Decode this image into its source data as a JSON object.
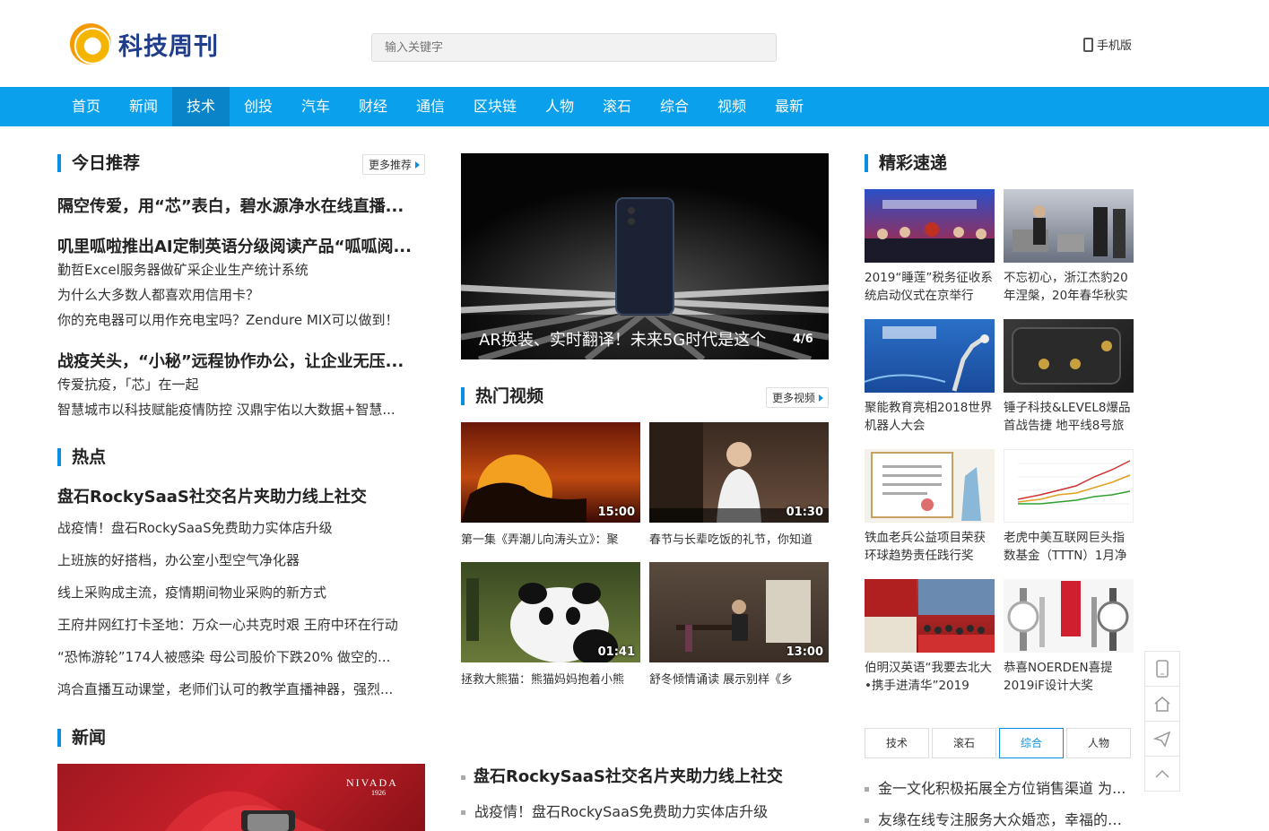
{
  "header": {
    "logo_text": "科技周刊",
    "search_placeholder": "输入关键字",
    "mobile_label": "手机版"
  },
  "nav": [
    "首页",
    "新闻",
    "技术",
    "创投",
    "汽车",
    "财经",
    "通信",
    "区块链",
    "人物",
    "滚石",
    "综合",
    "视频",
    "最新"
  ],
  "nav_active": "技术",
  "today": {
    "title": "今日推荐",
    "more": "更多推荐",
    "groups": [
      {
        "headline": "隔空传爱，用“芯”表白，碧水源净水在线直播...",
        "links": []
      },
      {
        "headline": "叽里呱啦推出AI定制英语分级阅读产品“呱呱阅...",
        "links": [
          "勤哲Excel服务器做矿采企业生产统计系统",
          "为什么大多数人都喜欢用信用卡？",
          "你的充电器可以用作充电宝吗？Zendure MIX可以做到！"
        ]
      },
      {
        "headline": "战疫关头，“小秘”远程协作办公，让企业无压...",
        "links": [
          "传爱抗疫，「芯」在一起",
          "智慧城市以科技赋能疫情防控 汉鼎宇佑以大数据+智慧..."
        ]
      }
    ]
  },
  "hot": {
    "title": "热点",
    "headline": "盘石RockySaaS社交名片夹助力线上社交",
    "links": [
      "战疫情！盘石RockySaaS免费助力实体店升级",
      "上班族的好搭档，办公室小型空气净化器",
      "线上采购成主流，疫情期间物业采购的新方式",
      "王府井网红打卡圣地：万众一心共克时艰 王府中环在行动",
      "“恐怖游轮”174人被感染 母公司股价下跌20% 做空的...",
      "鸿合直播互动课堂，老师们认可的教学直播神器，强烈..."
    ]
  },
  "news": {
    "title": "新闻",
    "ad_brand": "NIVADA",
    "ad_year": "1926"
  },
  "slider": {
    "caption": "AR换装、实时翻译！未来5G时代是这个",
    "counter": "4/6"
  },
  "videos": {
    "title": "热门视频",
    "more": "更多视频",
    "items": [
      {
        "caption": "第一集《弄潮儿向涛头立》：聚",
        "duration": "15:00"
      },
      {
        "caption": "春节与长辈吃饭的礼节，你知道",
        "duration": "01:30"
      },
      {
        "caption": "拯救大熊猫：熊猫妈妈抱着小熊",
        "duration": "01:41"
      },
      {
        "caption": "舒冬倾情诵读 展示别样《乡",
        "duration": "13:00"
      }
    ]
  },
  "center_list": [
    "盘石RockySaaS社交名片夹助力线上社交",
    "战疫情！盘石RockySaaS免费助力实体店升级"
  ],
  "express": {
    "title": "精彩速递",
    "items": [
      {
        "caption": "2019“睡莲”税务征收系统启动仪式在京举行",
        "icon": "ceremony-photo"
      },
      {
        "caption": "不忘初心，浙江杰豹20年涅槃，20年春华秋实",
        "icon": "event-photo"
      },
      {
        "caption": "聚能教育亮相2018世界机器人大会",
        "icon": "robot-photo"
      },
      {
        "caption": "锤子科技&LEVEL8爆品首战告捷 地平线8号旅",
        "icon": "suitcase-photo"
      },
      {
        "caption": "铁血老兵公益项目荣获环球趋势责任践行奖",
        "icon": "certificate-photo"
      },
      {
        "caption": "老虎中美互联网巨头指数基金（TTTN）1月净",
        "icon": "chart-photo"
      },
      {
        "caption": "伯明汉英语“我要去北大•携手进清华”2019",
        "icon": "students-photo"
      },
      {
        "caption": "恭喜NOERDEN喜提2019iF设计大奖",
        "icon": "watch-photo"
      }
    ]
  },
  "tabs": {
    "items": [
      "技术",
      "滚石",
      "综合",
      "人物"
    ],
    "active": "综合"
  },
  "right_list": [
    "金一文化积极拓展全方位销售渠道 为...",
    "友缘在线专注服务大众婚恋，幸福的爱..."
  ],
  "colors": {
    "nav": "#0aa0ec",
    "nav_active": "#0a84c8",
    "accent": "#0a8fe0",
    "logo": "#1f3d8a"
  }
}
